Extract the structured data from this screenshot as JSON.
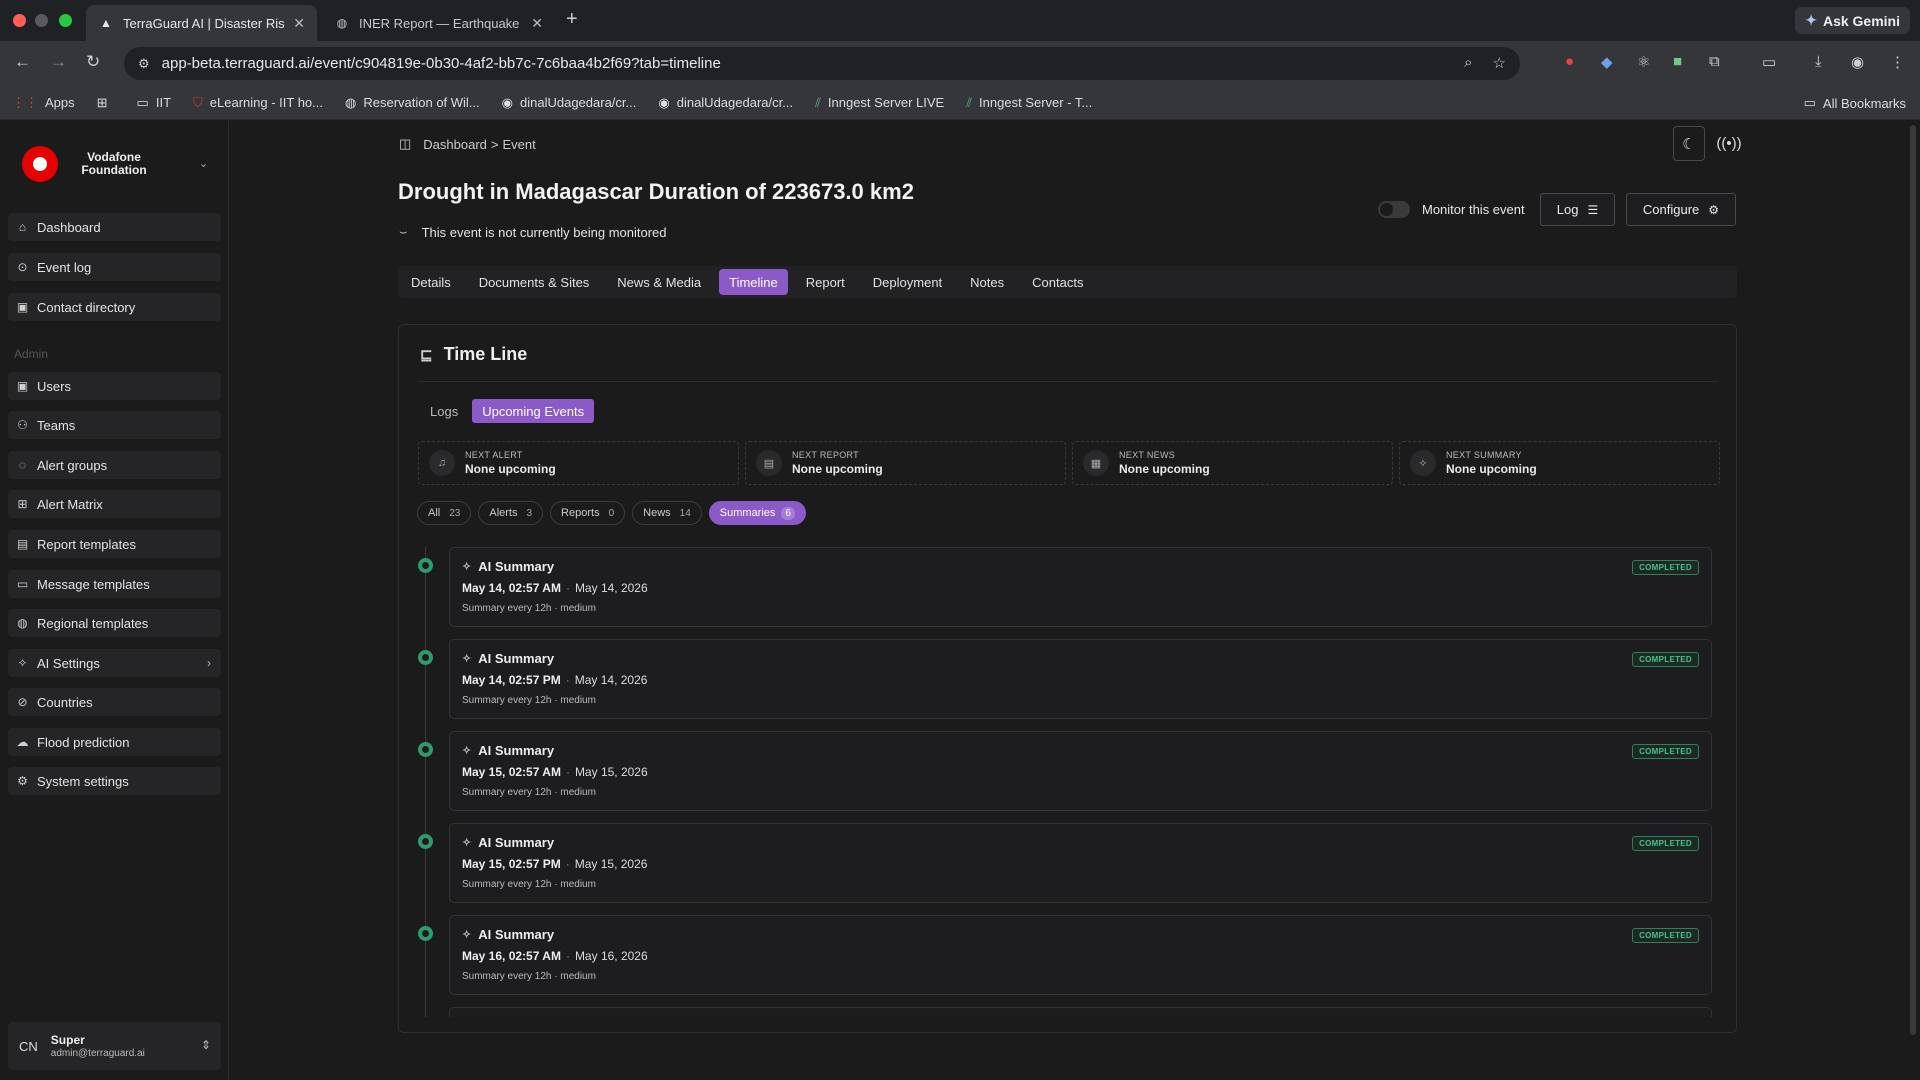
{
  "browser": {
    "tabs": [
      {
        "label": "TerraGuard AI | Disaster Risk I",
        "close": "✕"
      },
      {
        "label": "INER Report — Earthquake in",
        "close": "✕"
      }
    ],
    "new_tab": "+",
    "ask_gemini": "Ask Gemini",
    "url": "app-beta.terraguard.ai/event/c904819e-0b30-4af2-bb7c-7c6baa4b2f69?tab=timeline",
    "bookmarks": [
      {
        "label": "Apps",
        "icon": "apps-grid-icon"
      },
      {
        "label": "",
        "icon": "grid-icon"
      },
      {
        "label": "IIT",
        "icon": "folder-icon"
      },
      {
        "label": "eLearning - IIT ho...",
        "icon": "shield-icon"
      },
      {
        "label": "Reservation of Wil...",
        "icon": "globe-icon"
      },
      {
        "label": "dinalUdagedara/cr...",
        "icon": "github-icon"
      },
      {
        "label": "dinalUdagedara/cr...",
        "icon": "github-icon"
      },
      {
        "label": "Inngest Server LIVE",
        "icon": "inngest-icon"
      },
      {
        "label": "Inngest Server - T...",
        "icon": "inngest-icon"
      }
    ],
    "all_bookmarks": "All Bookmarks"
  },
  "sidebar": {
    "org_name": "Vodafone Foundation",
    "admin_label": "Admin",
    "items": [
      {
        "label": "Dashboard",
        "icon": "home-icon"
      },
      {
        "label": "Event log",
        "icon": "event-log-icon"
      },
      {
        "label": "Contact directory",
        "icon": "contact-icon"
      },
      {
        "label": "Users",
        "icon": "users-icon"
      },
      {
        "label": "Teams",
        "icon": "teams-icon"
      },
      {
        "label": "Alert groups",
        "icon": "alert-groups-icon"
      },
      {
        "label": "Alert Matrix",
        "icon": "matrix-icon"
      },
      {
        "label": "Report templates",
        "icon": "report-icon"
      },
      {
        "label": "Message templates",
        "icon": "message-icon"
      },
      {
        "label": "Regional templates",
        "icon": "globe-icon"
      },
      {
        "label": "AI Settings",
        "icon": "sparkle-icon"
      },
      {
        "label": "Countries",
        "icon": "countries-icon"
      },
      {
        "label": "Flood prediction",
        "icon": "cloud-icon"
      },
      {
        "label": "System settings",
        "icon": "gear-icon"
      }
    ],
    "user": {
      "initials": "CN",
      "name": "Super",
      "email": "admin@terraguard.ai"
    }
  },
  "main": {
    "breadcrumb": [
      "Dashboard",
      "Event"
    ],
    "breadcrumb_sep": ">",
    "title": "Drought in Madagascar Duration of 223673.0 km2",
    "monitor_note": "This event is not currently being monitored",
    "monitor_toggle_label": "Monitor this event",
    "monitor_on": false,
    "log_button": "Log",
    "configure_button": "Configure",
    "tabs": [
      "Details",
      "Documents & Sites",
      "News & Media",
      "Timeline",
      "Report",
      "Deployment",
      "Notes",
      "Contacts"
    ],
    "active_tab": "Timeline"
  },
  "timeline": {
    "title": "Time Line",
    "subtabs": [
      "Logs",
      "Upcoming Events"
    ],
    "active_subtab": "Upcoming Events",
    "upcoming": [
      {
        "label": "NEXT ALERT",
        "value": "None upcoming",
        "icon": "bell-icon"
      },
      {
        "label": "NEXT REPORT",
        "value": "None upcoming",
        "icon": "document-icon"
      },
      {
        "label": "NEXT NEWS",
        "value": "None upcoming",
        "icon": "newspaper-icon"
      },
      {
        "label": "NEXT SUMMARY",
        "value": "None upcoming",
        "icon": "sparkle-icon"
      }
    ],
    "filters": [
      {
        "label": "All",
        "count": "23"
      },
      {
        "label": "Alerts",
        "count": "3"
      },
      {
        "label": "Reports",
        "count": "0"
      },
      {
        "label": "News",
        "count": "14"
      },
      {
        "label": "Summaries",
        "count": "6"
      }
    ],
    "active_filter": "Summaries",
    "events": [
      {
        "title": "AI Summary",
        "datetime": "May 14, 02:57 AM",
        "date": "May 14, 2026",
        "meta": "Summary every 12h · medium",
        "status": "COMPLETED"
      },
      {
        "title": "AI Summary",
        "datetime": "May 14, 02:57 PM",
        "date": "May 14, 2026",
        "meta": "Summary every 12h · medium",
        "status": "COMPLETED"
      },
      {
        "title": "AI Summary",
        "datetime": "May 15, 02:57 AM",
        "date": "May 15, 2026",
        "meta": "Summary every 12h · medium",
        "status": "COMPLETED"
      },
      {
        "title": "AI Summary",
        "datetime": "May 15, 02:57 PM",
        "date": "May 15, 2026",
        "meta": "Summary every 12h · medium",
        "status": "COMPLETED"
      },
      {
        "title": "AI Summary",
        "datetime": "May 16, 02:57 AM",
        "date": "May 16, 2026",
        "meta": "Summary every 12h · medium",
        "status": "COMPLETED"
      }
    ]
  },
  "colors": {
    "accent": "#8b5ac8",
    "status_green": "#2f9a6c",
    "background": "#1b1b1c"
  }
}
